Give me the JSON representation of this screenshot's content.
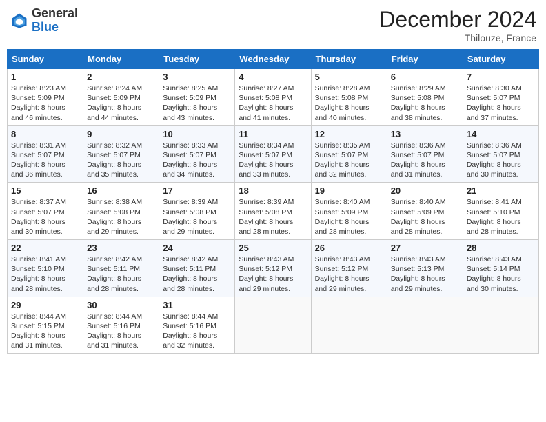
{
  "header": {
    "logo": {
      "line1": "General",
      "line2": "Blue"
    },
    "title": "December 2024",
    "location": "Thilouze, France"
  },
  "calendar": {
    "weekdays": [
      "Sunday",
      "Monday",
      "Tuesday",
      "Wednesday",
      "Thursday",
      "Friday",
      "Saturday"
    ],
    "weeks": [
      [
        {
          "day": "1",
          "info": "Sunrise: 8:23 AM\nSunset: 5:09 PM\nDaylight: 8 hours and 46 minutes."
        },
        {
          "day": "2",
          "info": "Sunrise: 8:24 AM\nSunset: 5:09 PM\nDaylight: 8 hours and 44 minutes."
        },
        {
          "day": "3",
          "info": "Sunrise: 8:25 AM\nSunset: 5:09 PM\nDaylight: 8 hours and 43 minutes."
        },
        {
          "day": "4",
          "info": "Sunrise: 8:27 AM\nSunset: 5:08 PM\nDaylight: 8 hours and 41 minutes."
        },
        {
          "day": "5",
          "info": "Sunrise: 8:28 AM\nSunset: 5:08 PM\nDaylight: 8 hours and 40 minutes."
        },
        {
          "day": "6",
          "info": "Sunrise: 8:29 AM\nSunset: 5:08 PM\nDaylight: 8 hours and 38 minutes."
        },
        {
          "day": "7",
          "info": "Sunrise: 8:30 AM\nSunset: 5:07 PM\nDaylight: 8 hours and 37 minutes."
        }
      ],
      [
        {
          "day": "8",
          "info": "Sunrise: 8:31 AM\nSunset: 5:07 PM\nDaylight: 8 hours and 36 minutes."
        },
        {
          "day": "9",
          "info": "Sunrise: 8:32 AM\nSunset: 5:07 PM\nDaylight: 8 hours and 35 minutes."
        },
        {
          "day": "10",
          "info": "Sunrise: 8:33 AM\nSunset: 5:07 PM\nDaylight: 8 hours and 34 minutes."
        },
        {
          "day": "11",
          "info": "Sunrise: 8:34 AM\nSunset: 5:07 PM\nDaylight: 8 hours and 33 minutes."
        },
        {
          "day": "12",
          "info": "Sunrise: 8:35 AM\nSunset: 5:07 PM\nDaylight: 8 hours and 32 minutes."
        },
        {
          "day": "13",
          "info": "Sunrise: 8:36 AM\nSunset: 5:07 PM\nDaylight: 8 hours and 31 minutes."
        },
        {
          "day": "14",
          "info": "Sunrise: 8:36 AM\nSunset: 5:07 PM\nDaylight: 8 hours and 30 minutes."
        }
      ],
      [
        {
          "day": "15",
          "info": "Sunrise: 8:37 AM\nSunset: 5:07 PM\nDaylight: 8 hours and 30 minutes."
        },
        {
          "day": "16",
          "info": "Sunrise: 8:38 AM\nSunset: 5:08 PM\nDaylight: 8 hours and 29 minutes."
        },
        {
          "day": "17",
          "info": "Sunrise: 8:39 AM\nSunset: 5:08 PM\nDaylight: 8 hours and 29 minutes."
        },
        {
          "day": "18",
          "info": "Sunrise: 8:39 AM\nSunset: 5:08 PM\nDaylight: 8 hours and 28 minutes."
        },
        {
          "day": "19",
          "info": "Sunrise: 8:40 AM\nSunset: 5:09 PM\nDaylight: 8 hours and 28 minutes."
        },
        {
          "day": "20",
          "info": "Sunrise: 8:40 AM\nSunset: 5:09 PM\nDaylight: 8 hours and 28 minutes."
        },
        {
          "day": "21",
          "info": "Sunrise: 8:41 AM\nSunset: 5:10 PM\nDaylight: 8 hours and 28 minutes."
        }
      ],
      [
        {
          "day": "22",
          "info": "Sunrise: 8:41 AM\nSunset: 5:10 PM\nDaylight: 8 hours and 28 minutes."
        },
        {
          "day": "23",
          "info": "Sunrise: 8:42 AM\nSunset: 5:11 PM\nDaylight: 8 hours and 28 minutes."
        },
        {
          "day": "24",
          "info": "Sunrise: 8:42 AM\nSunset: 5:11 PM\nDaylight: 8 hours and 28 minutes."
        },
        {
          "day": "25",
          "info": "Sunrise: 8:43 AM\nSunset: 5:12 PM\nDaylight: 8 hours and 29 minutes."
        },
        {
          "day": "26",
          "info": "Sunrise: 8:43 AM\nSunset: 5:12 PM\nDaylight: 8 hours and 29 minutes."
        },
        {
          "day": "27",
          "info": "Sunrise: 8:43 AM\nSunset: 5:13 PM\nDaylight: 8 hours and 29 minutes."
        },
        {
          "day": "28",
          "info": "Sunrise: 8:43 AM\nSunset: 5:14 PM\nDaylight: 8 hours and 30 minutes."
        }
      ],
      [
        {
          "day": "29",
          "info": "Sunrise: 8:44 AM\nSunset: 5:15 PM\nDaylight: 8 hours and 31 minutes."
        },
        {
          "day": "30",
          "info": "Sunrise: 8:44 AM\nSunset: 5:16 PM\nDaylight: 8 hours and 31 minutes."
        },
        {
          "day": "31",
          "info": "Sunrise: 8:44 AM\nSunset: 5:16 PM\nDaylight: 8 hours and 32 minutes."
        },
        {
          "day": "",
          "info": ""
        },
        {
          "day": "",
          "info": ""
        },
        {
          "day": "",
          "info": ""
        },
        {
          "day": "",
          "info": ""
        }
      ]
    ]
  }
}
